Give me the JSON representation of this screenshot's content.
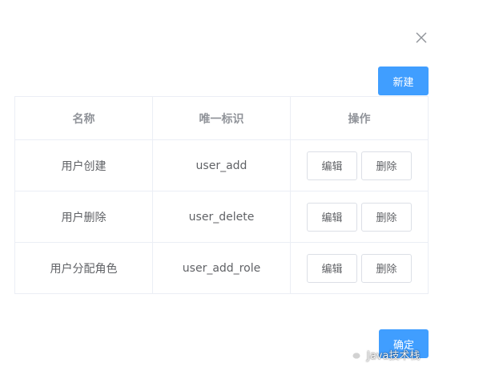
{
  "dialog": {
    "close_icon": "close-icon",
    "new_button_label": "新建",
    "confirm_button_label": "确定"
  },
  "table": {
    "headers": [
      "名称",
      "唯一标识",
      "操作"
    ],
    "rows": [
      {
        "name": "用户创建",
        "identifier": "user_add",
        "edit_label": "编辑",
        "delete_label": "删除"
      },
      {
        "name": "用户删除",
        "identifier": "user_delete",
        "edit_label": "编辑",
        "delete_label": "删除"
      },
      {
        "name": "用户分配角色",
        "identifier": "user_add_role",
        "edit_label": "编辑",
        "delete_label": "删除"
      }
    ]
  },
  "watermark": {
    "icon": "wechat-icon",
    "text": "Java技术栈"
  },
  "colors": {
    "primary": "#409eff",
    "border": "#ebeef5",
    "text": "#606266",
    "header_text": "#909399"
  }
}
